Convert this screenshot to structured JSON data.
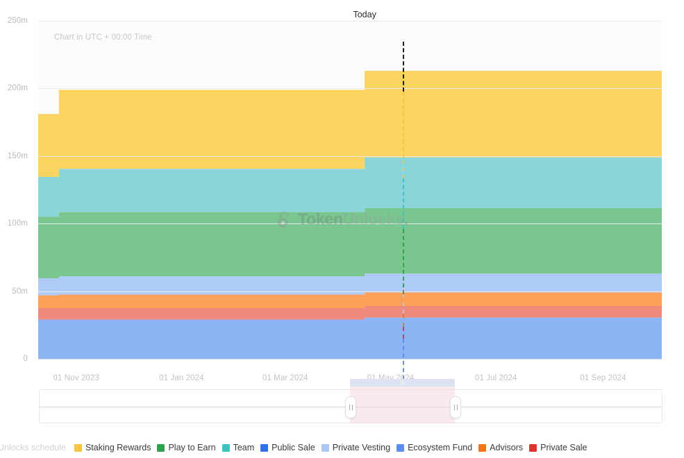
{
  "header": {
    "today_label": "Today",
    "utc_note": "Chart in UTC + 00:00 Time"
  },
  "watermark": {
    "strong": "Token",
    "dim": "Unlocks",
    "dot": "."
  },
  "legend": {
    "title": "Unlocks schedule",
    "items": [
      {
        "label": "Staking Rewards",
        "color": "#f7c53e"
      },
      {
        "label": "Play to Earn",
        "color": "#2ea14f"
      },
      {
        "label": "Team",
        "color": "#3cc4c0"
      },
      {
        "label": "Public Sale",
        "color": "#2f72e8"
      },
      {
        "label": "Private Vesting",
        "color": "#adc6ef"
      },
      {
        "label": "Ecosystem Fund",
        "color": "#5b8def"
      },
      {
        "label": "Advisors",
        "color": "#f97316"
      },
      {
        "label": "Private Sale",
        "color": "#e83030"
      }
    ]
  },
  "navigator": {
    "selection_start_pct": 49.8,
    "selection_end_pct": 66.6,
    "handle_grip": "||",
    "cap_grip": "|||"
  },
  "chart_data": {
    "type": "area",
    "title": "",
    "subtitle": "Chart in UTC + 00:00 Time",
    "xlabel": "",
    "ylabel": "",
    "stacked": true,
    "step": true,
    "grid": true,
    "legend_position": "bottom",
    "ylim": [
      0,
      250000000
    ],
    "ytick_labels": [
      "0",
      "50m",
      "100m",
      "150m",
      "200m",
      "250m"
    ],
    "ytick_values": [
      0,
      50000000,
      100000000,
      150000000,
      200000000,
      250000000
    ],
    "xtick_labels": [
      "01 Nov 2023",
      "01 Jan 2024",
      "01 Mar 2024",
      "01 May 2024",
      "01 Jul 2024",
      "01 Sep 2024"
    ],
    "xlim": [
      "2023-10-10",
      "2024-10-05"
    ],
    "annotations": [
      {
        "label": "Today",
        "type": "vline",
        "x": "2024-04-16",
        "style": "dashed"
      }
    ],
    "series_stack_order_bottom_to_top": [
      "Ecosystem Fund",
      "Private Sale",
      "Advisors",
      "Private Vesting",
      "Play to Earn",
      "Team",
      "Staking Rewards"
    ],
    "series": [
      {
        "name": "Ecosystem Fund",
        "color": "#8cb4f5",
        "x": [
          "2023-10-10",
          "2023-10-22",
          "2024-04-16",
          "2024-10-05"
        ],
        "values": [
          29000000,
          29000000,
          30500000,
          30500000
        ]
      },
      {
        "name": "Private Sale",
        "color": "#ef8a7d",
        "x": [
          "2023-10-10",
          "2023-10-22",
          "2024-04-16",
          "2024-10-05"
        ],
        "values": [
          8500000,
          8500000,
          8500000,
          8500000
        ]
      },
      {
        "name": "Advisors",
        "color": "#fda05a",
        "x": [
          "2023-10-10",
          "2023-10-22",
          "2024-04-16",
          "2024-10-05"
        ],
        "values": [
          9500000,
          10000000,
          10000000,
          10000000
        ]
      },
      {
        "name": "Private Vesting",
        "color": "#aecbf7",
        "x": [
          "2023-10-10",
          "2023-10-22",
          "2024-04-16",
          "2024-10-05"
        ],
        "values": [
          12500000,
          13500000,
          14000000,
          14000000
        ]
      },
      {
        "name": "Play to Earn",
        "color": "#7ac68f",
        "x": [
          "2023-10-10",
          "2023-10-22",
          "2024-04-16",
          "2024-10-05"
        ],
        "values": [
          45500000,
          47500000,
          48500000,
          48500000
        ]
      },
      {
        "name": "Team",
        "color": "#8bd5da",
        "x": [
          "2023-10-10",
          "2023-10-22",
          "2024-04-16",
          "2024-10-05"
        ],
        "values": [
          29500000,
          32000000,
          37500000,
          37500000
        ]
      },
      {
        "name": "Staking Rewards",
        "color": "#f9d45f",
        "x": [
          "2023-10-10",
          "2023-10-22",
          "2024-02-27",
          "2024-04-16",
          "2024-07-10",
          "2024-10-05"
        ],
        "values": [
          46500000,
          58500000,
          58500000,
          64000000,
          64000000,
          64000000
        ]
      }
    ]
  }
}
